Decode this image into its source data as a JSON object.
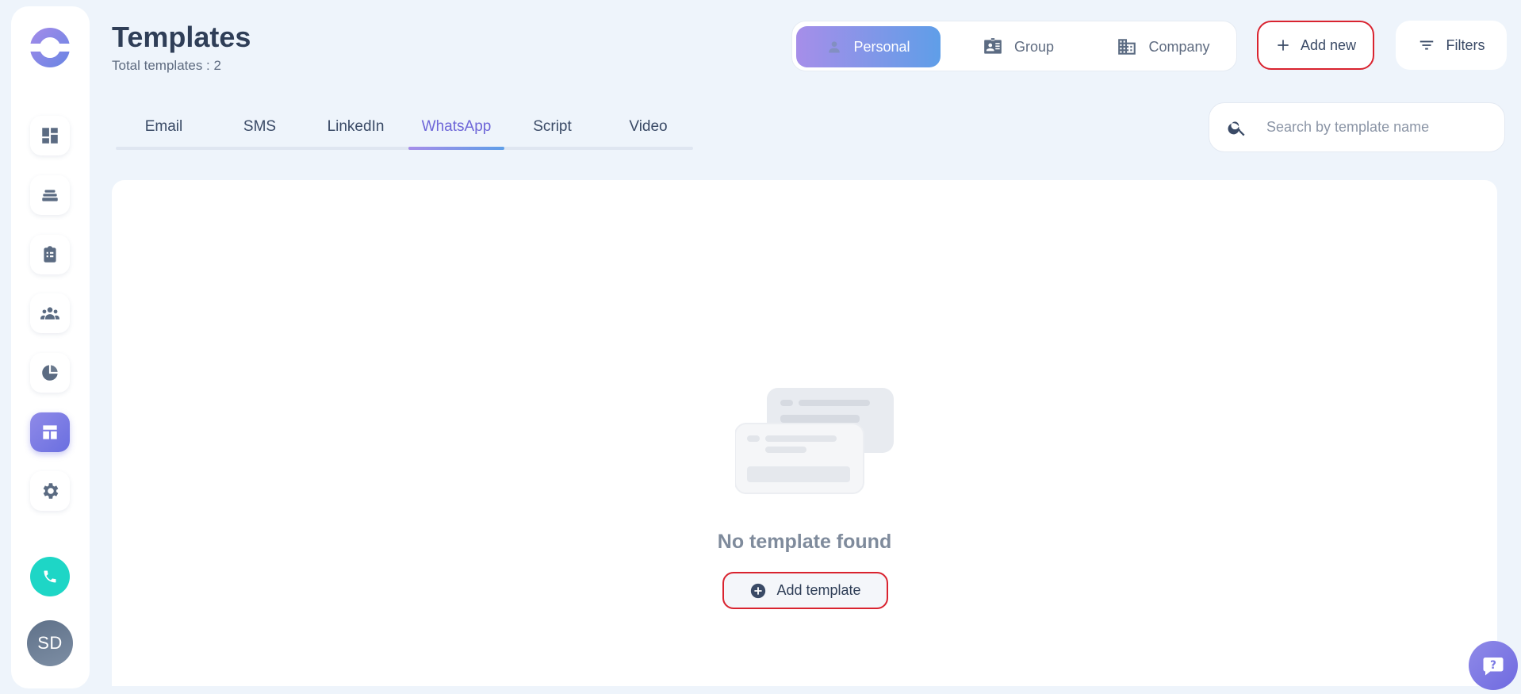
{
  "header": {
    "title": "Templates",
    "subtitle": "Total templates : 2"
  },
  "scope": {
    "items": [
      {
        "label": "Personal",
        "icon": "user-icon",
        "active": true
      },
      {
        "label": "Group",
        "icon": "id-card-icon",
        "active": false
      },
      {
        "label": "Company",
        "icon": "building-icon",
        "active": false
      }
    ]
  },
  "actions": {
    "add_new_label": "Add new",
    "filters_label": "Filters"
  },
  "tabs": [
    {
      "label": "Email",
      "active": false
    },
    {
      "label": "SMS",
      "active": false
    },
    {
      "label": "LinkedIn",
      "active": false
    },
    {
      "label": "WhatsApp",
      "active": true
    },
    {
      "label": "Script",
      "active": false
    },
    {
      "label": "Video",
      "active": false
    }
  ],
  "search": {
    "placeholder": "Search by template name",
    "value": ""
  },
  "empty_state": {
    "message": "No template found",
    "button_label": "Add template"
  },
  "sidebar": {
    "items": [
      {
        "icon": "dashboard-icon",
        "active": false
      },
      {
        "icon": "layers-icon",
        "active": false
      },
      {
        "icon": "clipboard-list-icon",
        "active": false
      },
      {
        "icon": "team-icon",
        "active": false
      },
      {
        "icon": "pie-chart-icon",
        "active": false
      },
      {
        "icon": "template-layout-icon",
        "active": true
      },
      {
        "icon": "gear-icon",
        "active": false
      }
    ],
    "user_initials": "SD"
  },
  "colors": {
    "accent": "#7a78e4",
    "highlight_border": "#d9232f",
    "phone": "#1ed6c6"
  }
}
